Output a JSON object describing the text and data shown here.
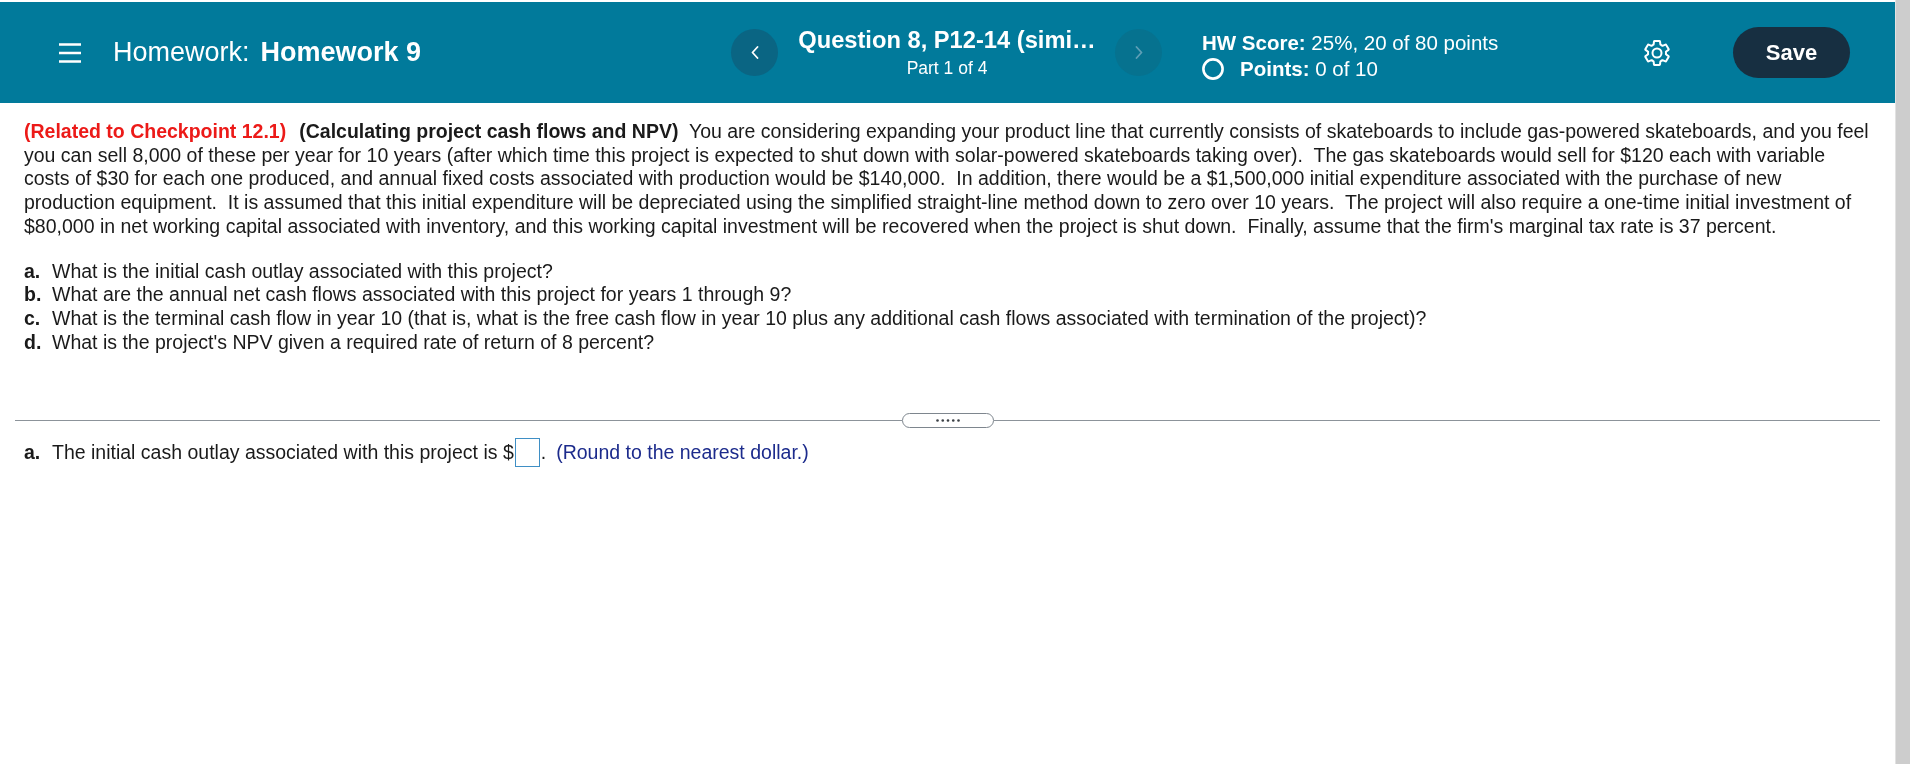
{
  "header": {
    "assignment_label": "Homework:",
    "assignment_title": "Homework 9",
    "previous_button": {
      "disabled": false
    },
    "question": {
      "title": "Question 8, P12-14 (simi…",
      "part": "Part 1 of 4"
    },
    "next_button": {
      "disabled": true
    },
    "score": {
      "label": "HW Score:",
      "value": "25%, 20 of 80 points"
    },
    "points": {
      "label": "Points:",
      "value": "0 of 10"
    },
    "save_button": {
      "label": "Save"
    }
  },
  "problem": {
    "reference": "(Related to Checkpoint 12.1)",
    "text": "**(Calculating project cash flows and NPV)**  You are considering expanding your product line that currently consists of skateboards to include gas-powered skateboards, and you feel you can sell 8,000 of these per year for 10 years (after which time this project is expected to shut down with solar-powered skateboards taking over).  The gas skateboards would sell for $120 each with variable costs of $30 for each one produced, and annual fixed costs associated with production would be $140,000.  In addition, there would be a $1,500,000 initial expenditure associated with the purchase of new production equipment.  It is assumed that this initial expenditure will be depreciated using the simplified straight-line method down to zero over 10 years.  The project will also require a one-time initial investment of $80,000 in net working capital associated with inventory, and this working capital investment will be recovered when the project is shut down.  Finally, assume that the firm's marginal tax rate is 37 percent."
  },
  "questions": [
    {
      "letter": "a.",
      "text": "What is the initial cash outlay associated with this project?"
    },
    {
      "letter": "b.",
      "text": "What are the annual net cash flows associated with this project for years 1 through 9?"
    },
    {
      "letter": "c.",
      "text": "What is the terminal cash flow in year 10 (that is, what is the free cash flow in year 10 plus any additional cash flows associated with termination of the project)?"
    },
    {
      "letter": "d.",
      "text": "What is the project's NPV given a required rate of return of 8 percent?"
    }
  ],
  "answer": {
    "letter": "a.",
    "prompt": "The initial cash outlay associated with this project is $",
    "suffix": ".",
    "hint": "(Round to the nearest dollar.)"
  }
}
